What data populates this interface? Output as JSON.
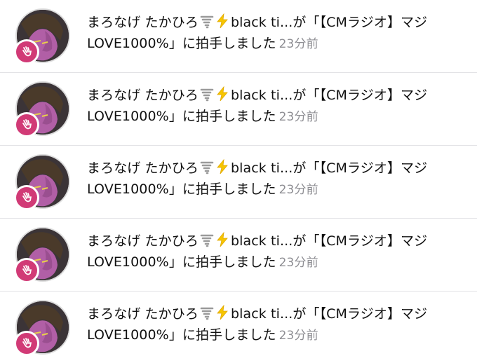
{
  "notifications": [
    {
      "user_name": "まろなげ たかひろ",
      "emoji_1": "tornado-icon",
      "emoji_2": "lightning-icon",
      "user_suffix": "black ti...",
      "message": "が「【CMラジオ】マジLOVE1000%」に拍手しました",
      "time": "23分前",
      "badge_icon": "clap-hands-icon"
    },
    {
      "user_name": "まろなげ たかひろ",
      "emoji_1": "tornado-icon",
      "emoji_2": "lightning-icon",
      "user_suffix": "black ti...",
      "message": "が「【CMラジオ】マジLOVE1000%」に拍手しました",
      "time": "23分前",
      "badge_icon": "clap-hands-icon"
    },
    {
      "user_name": "まろなげ たかひろ",
      "emoji_1": "tornado-icon",
      "emoji_2": "lightning-icon",
      "user_suffix": "black ti...",
      "message": "が「【CMラジオ】マジLOVE1000%」に拍手しました",
      "time": "23分前",
      "badge_icon": "clap-hands-icon"
    },
    {
      "user_name": "まろなげ たかひろ",
      "emoji_1": "tornado-icon",
      "emoji_2": "lightning-icon",
      "user_suffix": "black ti...",
      "message": "が「【CMラジオ】マジLOVE1000%」に拍手しました",
      "time": "23分前",
      "badge_icon": "clap-hands-icon"
    },
    {
      "user_name": "まろなげ たかひろ",
      "emoji_1": "tornado-icon",
      "emoji_2": "lightning-icon",
      "user_suffix": "black ti...",
      "message": "が「【CMラジオ】マジLOVE1000%」に拍手しました",
      "time": "23分前",
      "badge_icon": "clap-hands-icon"
    }
  ],
  "colors": {
    "badge": "#d13a76",
    "time_text": "#8e8e93",
    "divider": "#e3e3e6"
  }
}
